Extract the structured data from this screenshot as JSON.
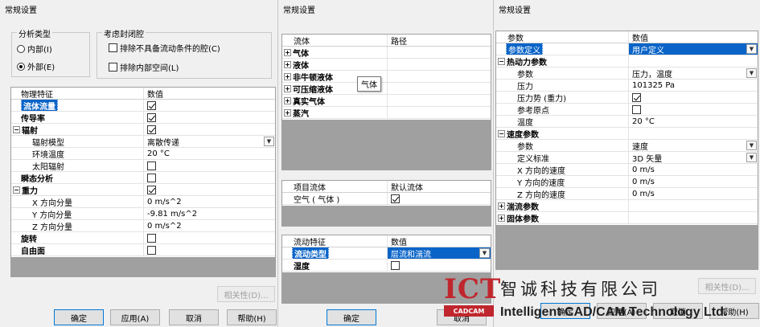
{
  "panel1": {
    "title": "常规设置",
    "analysis_type": {
      "caption": "分析类型",
      "internal": "内部(I)",
      "external": "外部(E)",
      "selected": "external"
    },
    "closed_cavity": {
      "caption": "考虑封闭腔",
      "exclude_no_flow": "排除不具备流动条件的腔(C)",
      "exclude_internal": "排除内部空间(L)"
    },
    "grid": {
      "col1": "物理特征",
      "col2": "数值",
      "rows": [
        {
          "label": "流体流量",
          "value": "",
          "check": true
        },
        {
          "label": "传导率",
          "value": "",
          "check": true
        },
        {
          "label": "辐射",
          "value": "",
          "check": true
        },
        {
          "label": "辐射模型",
          "value": "离散传递"
        },
        {
          "label": "环境温度",
          "value": "20 °C"
        },
        {
          "label": "太阳辐射",
          "value": "",
          "check": false
        },
        {
          "label": "瞬态分析",
          "value": "",
          "check": false
        },
        {
          "label": "重力",
          "value": "",
          "check": true
        },
        {
          "label": "X 方向分量",
          "value": "0 m/s^2"
        },
        {
          "label": "Y 方向分量",
          "value": "-9.81 m/s^2"
        },
        {
          "label": "Z 方向分量",
          "value": "0 m/s^2"
        },
        {
          "label": "旋转",
          "value": "",
          "check": false
        },
        {
          "label": "自由面",
          "value": "",
          "check": false
        }
      ]
    },
    "dependency_button": "相关性(D)...",
    "ok": "确定",
    "apply": "应用(A)",
    "cancel": "取消",
    "help": "帮助(H)"
  },
  "panel2": {
    "title": "常规设置",
    "fluid_grid": {
      "col1": "流体",
      "col2": "路径",
      "items": [
        "气体",
        "液体",
        "非牛顿液体",
        "可压缩液体",
        "真实气体",
        "蒸汽"
      ]
    },
    "tooltip": "气体",
    "project_grid": {
      "col1": "项目流体",
      "col2": "默认流体",
      "row_label": "空气 ( 气体 )"
    },
    "flow_grid": {
      "col1": "流动特征",
      "col2": "数值",
      "flow_type_label": "流动类型",
      "flow_type_value": "层流和湍流",
      "humidity_label": "湿度"
    },
    "ok": "确定",
    "cancel": "取消"
  },
  "panel3": {
    "title": "常规设置",
    "grid": {
      "col1": "参数",
      "col2": "数值",
      "rows": [
        {
          "label": "参数定义",
          "value": "用户定义"
        },
        {
          "label": "热动力参数",
          "value": ""
        },
        {
          "label": "参数",
          "value": "压力，温度"
        },
        {
          "label": "压力",
          "value": "101325 Pa"
        },
        {
          "label": "压力势 (重力)",
          "value": ""
        },
        {
          "label": "参考原点",
          "value": ""
        },
        {
          "label": "温度",
          "value": "20 °C"
        },
        {
          "label": "速度参数",
          "value": ""
        },
        {
          "label": "参数",
          "value": "速度"
        },
        {
          "label": "定义标准",
          "value": "3D 矢量"
        },
        {
          "label": "X 方向的速度",
          "value": "0 m/s"
        },
        {
          "label": "Y 方向的速度",
          "value": "0 m/s"
        },
        {
          "label": "Z 方向的速度",
          "value": "0 m/s"
        },
        {
          "label": "湍流参数",
          "value": ""
        },
        {
          "label": "固体参数",
          "value": ""
        }
      ]
    },
    "dependency_button": "相关性(D)...",
    "ok": "确定",
    "apply": "应用(A)",
    "cancel": "取消",
    "help": "帮助(H)"
  },
  "watermark": {
    "logo_text": "ICT",
    "logo_bar": "CADCAM",
    "company_cn": "智诚科技有限公司",
    "company_en": "Intelligent CAD/CAM Technology Ltd."
  },
  "colors": {
    "selection": "#0a64c8",
    "dialog_bg": "#f0f0f0",
    "brand_red": "#c0262d"
  }
}
